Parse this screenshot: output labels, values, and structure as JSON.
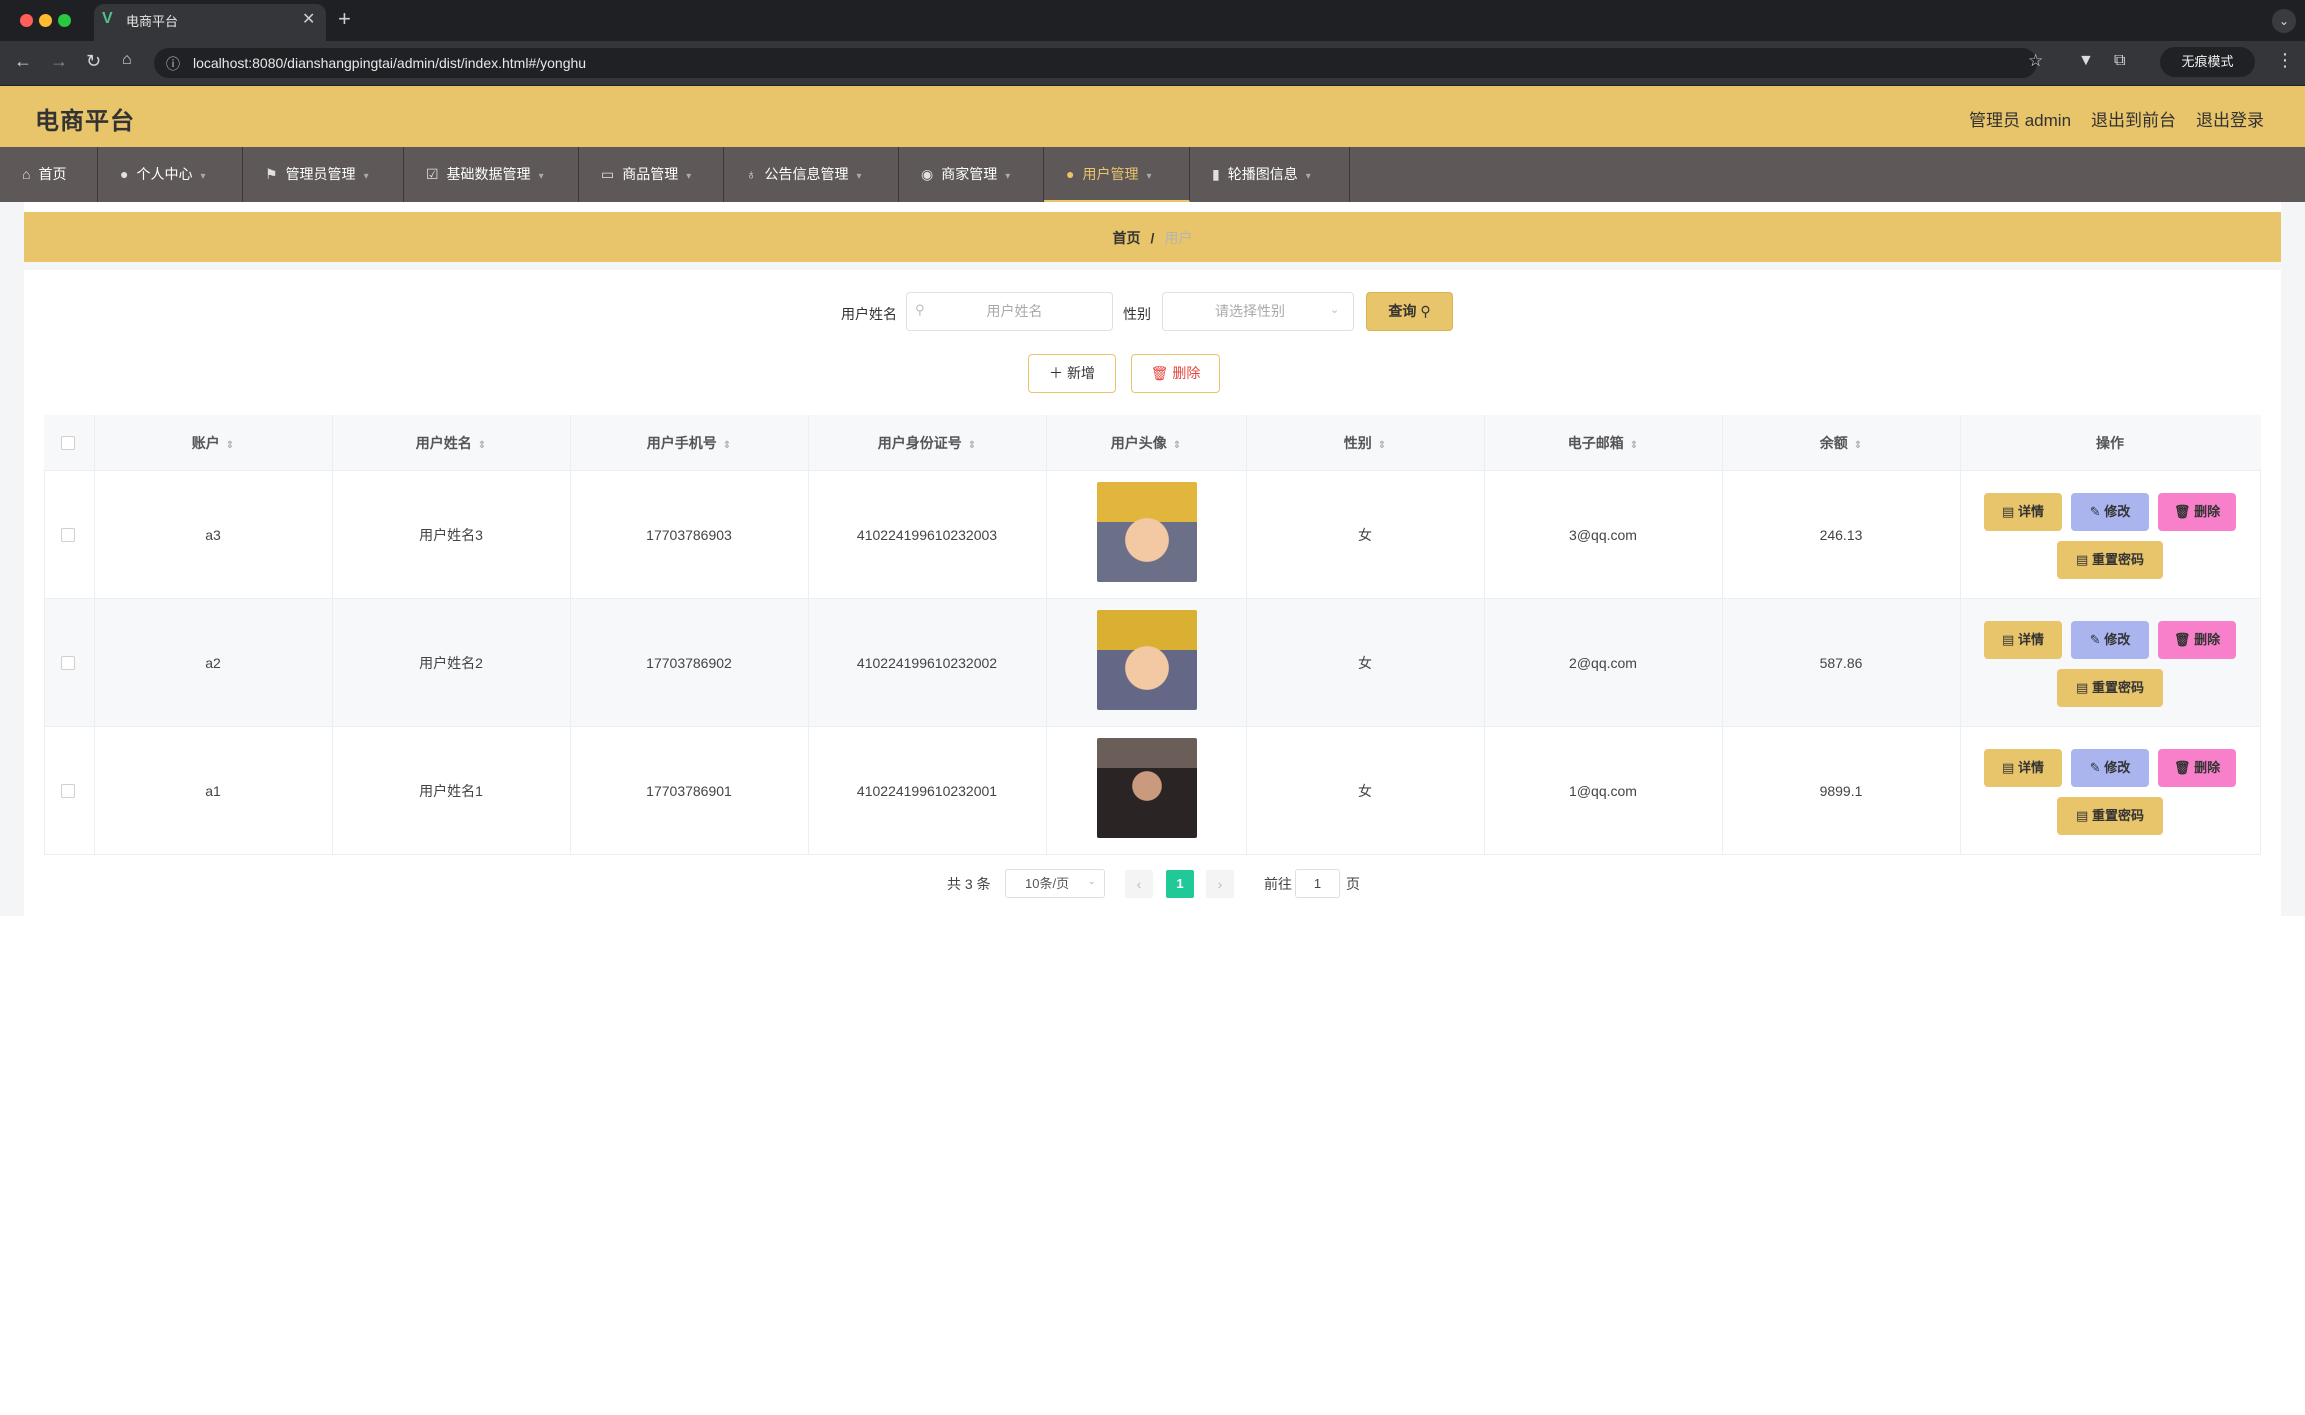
{
  "browser": {
    "tab_title": "电商平台",
    "url": "localhost:8080/dianshangpingtai/admin/dist/index.html#/yonghu",
    "incognito_label": "无痕模式"
  },
  "header": {
    "title": "电商平台",
    "admin_label": "管理员 admin",
    "front_link": "退出到前台",
    "logout_link": "退出登录"
  },
  "nav": {
    "items": [
      {
        "label": "首页",
        "icon": "home-icon"
      },
      {
        "label": "个人中心",
        "icon": "user-icon"
      },
      {
        "label": "管理员管理",
        "icon": "flag-icon"
      },
      {
        "label": "基础数据管理",
        "icon": "checkbox-icon"
      },
      {
        "label": "商品管理",
        "icon": "card-icon"
      },
      {
        "label": "公告信息管理",
        "icon": "mic-icon"
      },
      {
        "label": "商家管理",
        "icon": "location-icon"
      },
      {
        "label": "用户管理",
        "icon": "user-icon"
      },
      {
        "label": "轮播图信息",
        "icon": "chart-icon"
      }
    ],
    "active_index": 7
  },
  "breadcrumb": {
    "home": "首页",
    "separator": "/",
    "current": "用户"
  },
  "search": {
    "name_label": "用户姓名",
    "name_placeholder": "用户姓名",
    "sex_label": "性别",
    "sex_placeholder": "请选择性别",
    "query_label": "查询"
  },
  "actions": {
    "add_label": "新增",
    "delete_label": "删除"
  },
  "table": {
    "columns": [
      "账户",
      "用户姓名",
      "用户手机号",
      "用户身份证号",
      "用户头像",
      "性别",
      "电子邮箱",
      "余额",
      "操作"
    ],
    "rows": [
      {
        "account": "a3",
        "name": "用户姓名3",
        "phone": "17703786903",
        "id_card": "410224199610232003",
        "sex": "女",
        "email": "3@qq.com",
        "balance": "246.13"
      },
      {
        "account": "a2",
        "name": "用户姓名2",
        "phone": "17703786902",
        "id_card": "410224199610232002",
        "sex": "女",
        "email": "2@qq.com",
        "balance": "587.86"
      },
      {
        "account": "a1",
        "name": "用户姓名1",
        "phone": "17703786901",
        "id_card": "410224199610232001",
        "sex": "女",
        "email": "1@qq.com",
        "balance": "9899.1"
      }
    ],
    "op_labels": {
      "detail": "详情",
      "edit": "修改",
      "delete": "删除",
      "reset": "重置密码"
    }
  },
  "pagination": {
    "total_text": "共 3 条",
    "page_size": "10条/页",
    "current_page": "1",
    "goto_label": "前往",
    "goto_value": "1",
    "page_suffix": "页"
  },
  "colors": {
    "accent": "#e8c46a",
    "nav_bg": "#5e5859",
    "edit_btn": "#aab4ee",
    "delete_btn": "#f87fc9",
    "page_active": "#20c997"
  }
}
